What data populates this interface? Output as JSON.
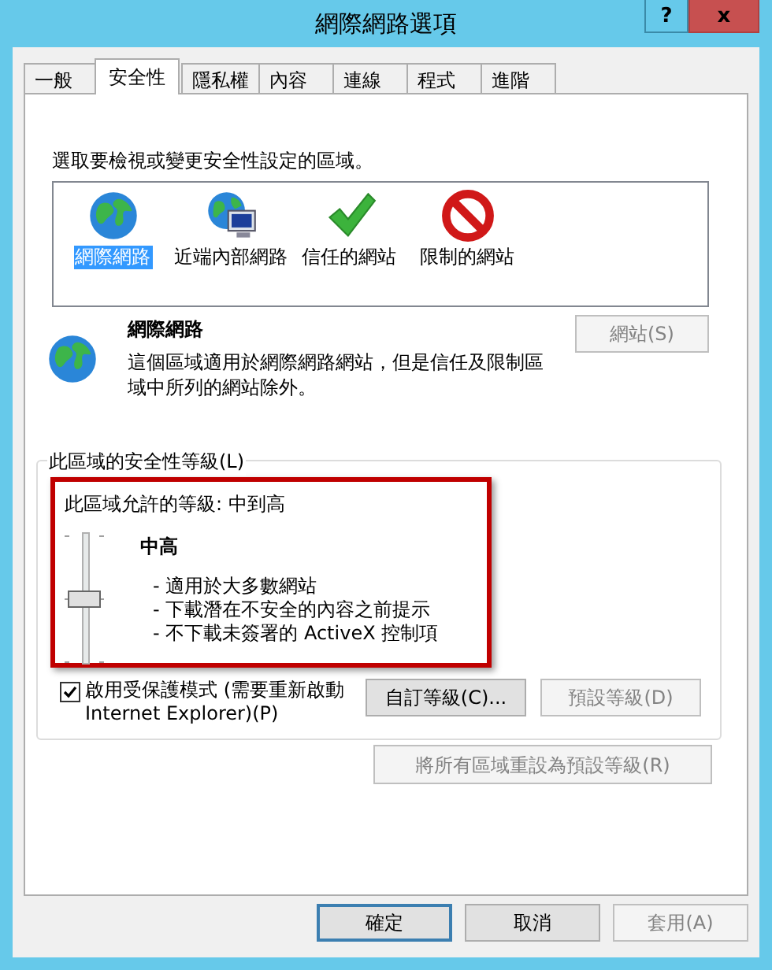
{
  "window": {
    "title": "網際網路選項",
    "help_button": "?",
    "close_button": "x"
  },
  "tabs": [
    {
      "label": "一般",
      "selected": false
    },
    {
      "label": "安全性",
      "selected": true
    },
    {
      "label": "隱私權",
      "selected": false
    },
    {
      "label": "內容",
      "selected": false
    },
    {
      "label": "連線",
      "selected": false
    },
    {
      "label": "程式",
      "selected": false
    },
    {
      "label": "進階",
      "selected": false
    }
  ],
  "zone_prompt": "選取要檢視或變更安全性設定的區域。",
  "zones": [
    {
      "label": "網際網路",
      "kind": "internet",
      "selected": true
    },
    {
      "label": "近端內部網路",
      "kind": "intranet",
      "selected": false
    },
    {
      "label": "信任的網站",
      "kind": "trusted",
      "selected": false
    },
    {
      "label": "限制的網站",
      "kind": "restricted",
      "selected": false
    }
  ],
  "zone_info": {
    "kind": "internet",
    "title": "網際網路",
    "description": "這個區域適用於網際網路網站，但是信任及限制區域中所列的網站除外。",
    "sites_button": {
      "label": "網站(S)",
      "disabled": true
    }
  },
  "security_level": {
    "legend": "此區域的安全性等級(L)",
    "highlighted": true,
    "allowed": "此區域允許的等級: 中到高",
    "level_name": "中高",
    "level": 0.5,
    "details": [
      "- 適用於大多數網站",
      "- 下載潛在不安全的內容之前提示",
      "- 不下載未簽署的 ActiveX 控制項"
    ],
    "protected_mode": {
      "label": "啟用受保護模式 (需要重新啟動 Internet Explorer)(P)",
      "checked": true
    },
    "buttons": [
      {
        "label": "自訂等級(C)...",
        "disabled": false
      },
      {
        "label": "預設等級(D)",
        "disabled": true
      }
    ]
  },
  "reset_button": {
    "label": "將所有區域重設為預設等級(R)",
    "disabled": true
  },
  "dialog_buttons": [
    {
      "label": "確定",
      "default": true,
      "disabled": false
    },
    {
      "label": "取消",
      "default": false,
      "disabled": false
    },
    {
      "label": "套用(A)",
      "default": false,
      "disabled": true
    }
  ]
}
